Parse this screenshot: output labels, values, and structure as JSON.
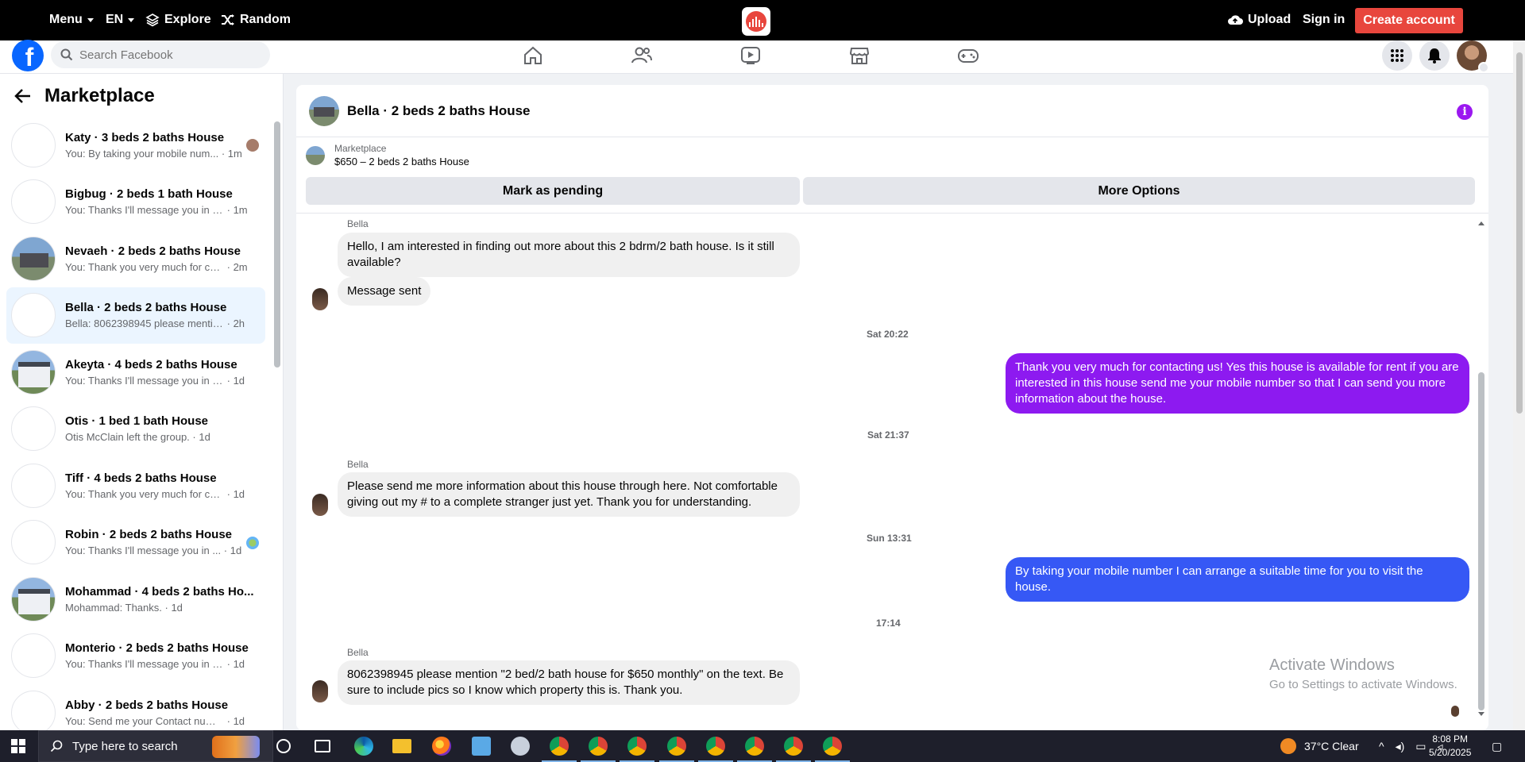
{
  "topbar": {
    "menu": "Menu",
    "lang": "EN",
    "explore": "Explore",
    "random": "Random",
    "upload": "Upload",
    "signin": "Sign in",
    "create": "Create account"
  },
  "fbnav": {
    "search_placeholder": "Search Facebook"
  },
  "sidebar": {
    "title": "Marketplace",
    "conversations": [
      {
        "title": "Katy · 3 beds 2 baths House",
        "preview": "You: By taking your mobile num...",
        "time": "· 1m"
      },
      {
        "title": "Bigbug · 2 beds 1 bath House",
        "preview": "You: Thanks I'll message you in a ...",
        "time": "· 1m"
      },
      {
        "title": "Nevaeh · 2 beds 2 baths House",
        "preview": "You: Thank you very much for cont...",
        "time": "· 2m"
      },
      {
        "title": "Bella · 2 beds 2 baths House",
        "preview": "Bella: 8062398945 please mention \"...",
        "time": "· 2h"
      },
      {
        "title": "Akeyta · 4 beds 2 baths House",
        "preview": "You: Thanks I'll message you in a m...",
        "time": "· 1d"
      },
      {
        "title": "Otis · 1 bed 1 bath House",
        "preview": "Otis McClain left the group.",
        "time": "· 1d"
      },
      {
        "title": "Tiff · 4 beds 2 baths House",
        "preview": "You: Thank you very much for cont...",
        "time": "· 1d"
      },
      {
        "title": "Robin · 2 beds 2 baths House",
        "preview": "You: Thanks I'll message you in ...",
        "time": "· 1d"
      },
      {
        "title": "Mohammad · 4 beds 2 baths Ho...",
        "preview": "Mohammad: Thanks.",
        "time": "· 1d"
      },
      {
        "title": "Monterio · 2 beds 2 baths House",
        "preview": "You: Thanks I'll message you in a m...",
        "time": "· 1d"
      },
      {
        "title": "Abby · 2 beds 2 baths House",
        "preview": "You: Send me your Contact number...",
        "time": "· 1d"
      }
    ]
  },
  "chat": {
    "title": "Bella · 2 beds 2 baths House",
    "listing_label": "Marketplace",
    "listing_price": "$650 – 2 beds 2 baths House",
    "mark_pending": "Mark as pending",
    "more_options": "More Options",
    "sender_name": "Bella",
    "messages": [
      {
        "text": "Hello, I am interested in finding out more about this 2 bdrm/2 bath house. Is it still available?"
      },
      {
        "text": "Message sent"
      },
      {
        "text": "Thank you very much for contacting us! Yes this house is available for rent if you are interested in this house send me your mobile number so that I can send you more information about the house."
      },
      {
        "text": "Please send me more information about this house through here. Not comfortable giving out my # to a complete stranger just yet. Thank you for understanding."
      },
      {
        "text": "By taking your mobile number I can arrange a suitable time for you to visit the house."
      },
      {
        "text": "8062398945 please mention \"2 bed/2 bath house for $650 monthly\" on the text. Be sure to include pics so I know which property this is. Thank you."
      }
    ],
    "timestamps": [
      "Sat 20:22",
      "Sat 21:37",
      "Sun 13:31",
      "17:14"
    ],
    "colors": {
      "outgoing_purple": "#8d1af0",
      "outgoing_blue": "#3658f5",
      "incoming": "#f0f0f0"
    }
  },
  "watermark": {
    "line1": "Activate Windows",
    "line2": "Go to Settings to activate Windows."
  },
  "taskbar": {
    "search_placeholder": "Type here to search",
    "weather": "37°C  Clear",
    "time": "8:08 PM",
    "date": "5/20/2025"
  }
}
